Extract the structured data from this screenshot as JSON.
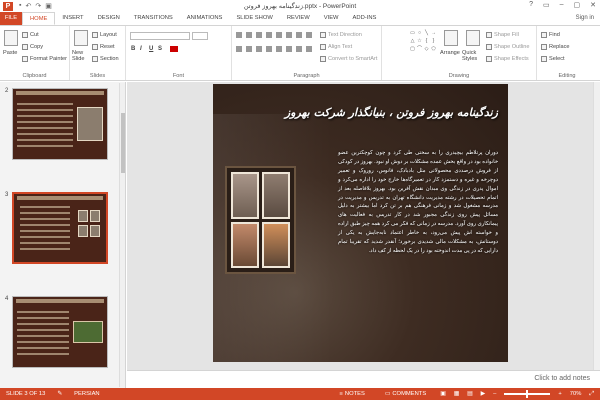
{
  "window": {
    "title": "زندگینامه بهروز فروتن.pptx - PowerPoint",
    "controls": [
      "?",
      "▭",
      "–",
      "▢",
      "✕"
    ]
  },
  "ribbon_tabs": [
    "FILE",
    "HOME",
    "INSERT",
    "DESIGN",
    "TRANSITIONS",
    "ANIMATIONS",
    "SLIDE SHOW",
    "REVIEW",
    "VIEW",
    "ADD-INS"
  ],
  "active_tab": "HOME",
  "sign_in": "Sign in",
  "clipboard": {
    "paste": "Paste",
    "cut": "Cut",
    "copy": "Copy",
    "format_painter": "Format Painter",
    "group": "Clipboard"
  },
  "slides_group": {
    "new_slide": "New Slide",
    "layout": "Layout",
    "reset": "Reset",
    "section": "Section",
    "group": "Slides"
  },
  "font_group": {
    "bold": "B",
    "italic": "I",
    "underline": "U",
    "strike": "S",
    "group": "Font"
  },
  "paragraph_group": {
    "text_direction": "Text Direction",
    "align_text": "Align Text",
    "convert_smartart": "Convert to SmartArt",
    "group": "Paragraph"
  },
  "drawing_group": {
    "arrange": "Arrange",
    "quick_styles": "Quick Styles",
    "shape_fill": "Shape Fill",
    "shape_outline": "Shape Outline",
    "shape_effects": "Shape Effects",
    "group": "Drawing"
  },
  "editing_group": {
    "find": "Find",
    "replace": "Replace",
    "select": "Select",
    "group": "Editing"
  },
  "thumbnails": {
    "n2": "2",
    "n3": "3",
    "n4": "4"
  },
  "slide": {
    "title": "زندگینامه بهروز فروتن ، بنیانگذار شرکت بهروز",
    "body": "دوران پرتلاطم بیچیدری را به سختی طی کرد و چون کوچکترین عضو خانواده بود در واقع بخش عمده مشکلات بر دوش او نبود. بهروز در کودکی از فروش درصددی محصولاتی مثل بادبادک، فانوس، روروک و تعمیر دوچرخه و غیره و دستمزد کار در تعمیرگاه‌ها خارج خود را اداره می‌کرد و اموال پدری در زندگی وی مبدان نقش آفرین بود. بهروز بلافاصله بعد از اتمام تحصیلات در رشته مدیریت دانشگاه تهران به تدریس و مدیریت در مدرسه مشغول شد و زمانی فرهنگی هم بر تن کرد اما بیشتر به دلیل مسائل پیش روی زندگی مجبور شد در کار تدریس به فعالیت های پیمانکاری روی آورد. مدرسه در زمانی که فکر می کرد همه چیز طبق اراده و خواسته اش پیش می‌رود، به خاطر اعتماد نابه‌جایش به یکی از دوستانش، به مشکلات مالی شدیدی برخورد؛ آنقدر شدید که تقریبا تمام دارایی که در پی مدت اندوخته بود را در یک لحظه از کف داد."
  },
  "notes_placeholder": "Click to add notes",
  "status": {
    "slide_count": "SLIDE 3 OF 13",
    "language": "PERSIAN",
    "notes": "NOTES",
    "comments": "COMMENTS",
    "zoom": "70%"
  }
}
